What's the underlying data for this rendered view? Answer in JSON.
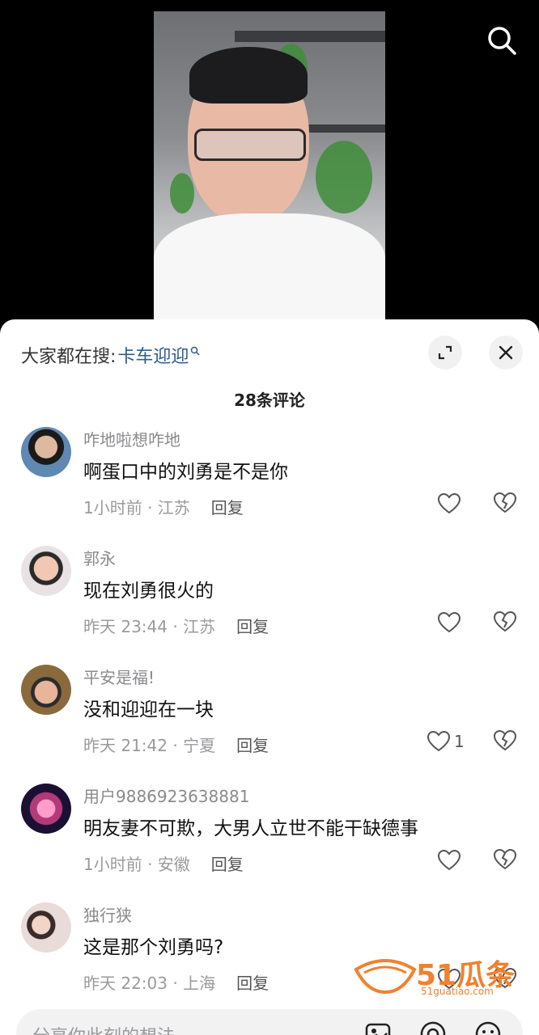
{
  "sheet": {
    "search_prefix": "大家都在搜:",
    "search_term": "卡车迎迎",
    "comment_count": "28条评论"
  },
  "comments": [
    {
      "username": "咋地啦想咋地",
      "content": "啊蛋口中的刘勇是不是你",
      "time_location": "1小时前 · 江苏",
      "reply": "回复",
      "likes": ""
    },
    {
      "username": "郭永",
      "content": "现在刘勇很火的",
      "time_location": "昨天 23:44 · 江苏",
      "reply": "回复",
      "likes": ""
    },
    {
      "username": "平安是福!",
      "content": "没和迎迎在一块",
      "time_location": "昨天 21:42 · 宁夏",
      "reply": "回复",
      "likes": "1"
    },
    {
      "username": "用户9886923638881",
      "content": "明友妻不可欺，大男人立世不能干缺德事",
      "time_location": "1小时前 · 安徽",
      "reply": "回复",
      "likes": ""
    },
    {
      "username": "独行狭",
      "content": "这是那个刘勇吗?",
      "time_location": "昨天 22:03 · 上海",
      "reply": "回复",
      "likes": ""
    }
  ],
  "input": {
    "placeholder": "分享你此刻的想法"
  },
  "watermark": {
    "brand": "51瓜条",
    "url": "51guatiao.com"
  },
  "icons": {
    "search": "search-icon",
    "expand": "expand-icon",
    "close": "close-icon",
    "like": "heart-icon",
    "dislike": "broken-heart-icon",
    "image": "image-icon",
    "mention": "at-icon",
    "emoji": "emoji-icon"
  }
}
